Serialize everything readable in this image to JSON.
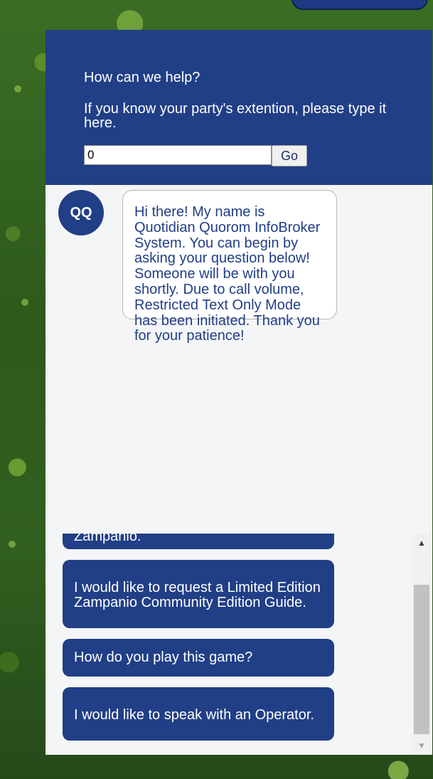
{
  "colors": {
    "brand": "#213f86",
    "panel_bg": "#f4f5f6",
    "bubble_text": "#213f86"
  },
  "header": {
    "title": "How can we help?",
    "instruction": "If you know your party's extention, please type it here.",
    "extension_value": "0",
    "go_label": "Go"
  },
  "chat": {
    "avatar_initials": "QQ",
    "message": "Hi there! My name is Quotidian Quorom InfoBroker System. You can begin by asking your question below! Someone will be with you shortly. Due to call volume, Restricted Text Only Mode has been initiated. Thank you for your patience!"
  },
  "options": [
    {
      "label": "Zampanio."
    },
    {
      "label": "I would like to request a Limited Edition Zampanio Community Edition Guide."
    },
    {
      "label": "How do you play this game?"
    },
    {
      "label": "I would like to speak with an Operator."
    }
  ],
  "scrollbar": {
    "up_icon": "triangle-up-icon",
    "down_icon": "triangle-down-icon"
  }
}
